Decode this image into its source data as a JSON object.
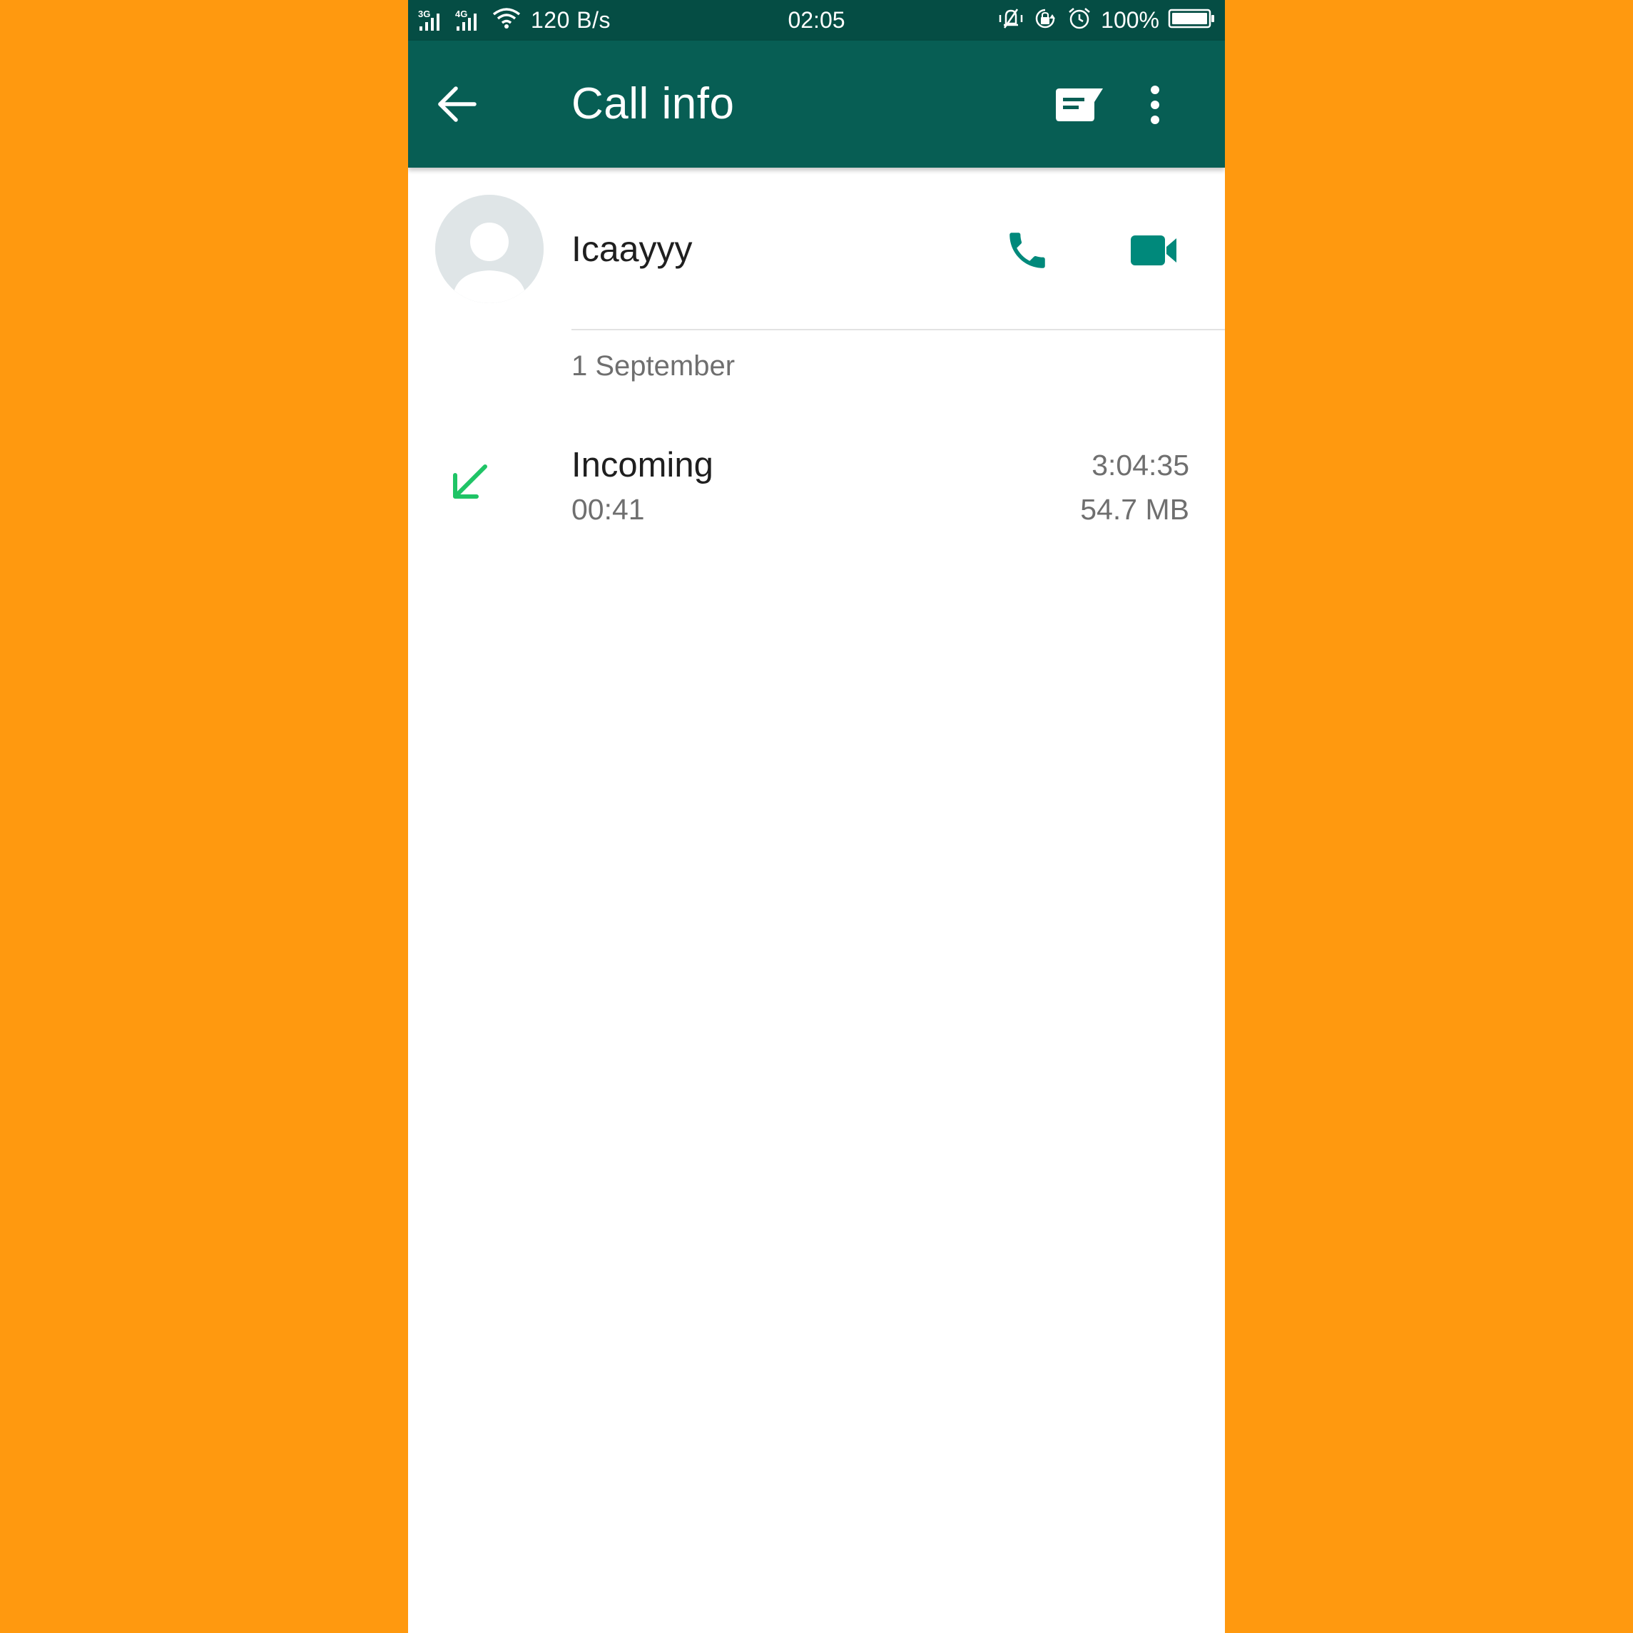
{
  "colors": {
    "background": "#FF990F",
    "status_bar": "#054D44",
    "app_bar": "#075E54",
    "accent": "#00897B",
    "incoming_arrow": "#1FC466",
    "avatar_bg": "#DFE5E7"
  },
  "status_bar": {
    "net1": "3G",
    "net2": "4G",
    "data_rate": "120 B/s",
    "time": "02:05",
    "battery": "100%",
    "icons": [
      "signal-icon",
      "wifi-icon",
      "vibrate-icon",
      "rotation-lock-icon",
      "alarm-icon",
      "battery-icon"
    ]
  },
  "app_bar": {
    "title": "Call info",
    "icons": [
      "back-arrow-icon",
      "message-icon",
      "more-vert-icon"
    ]
  },
  "contact": {
    "name": "Icaayyy",
    "icons": [
      "avatar-icon",
      "phone-icon",
      "video-camera-icon"
    ]
  },
  "call_log": {
    "date": "1 September",
    "entries": [
      {
        "direction_icon": "incoming-arrow-icon",
        "type": "Incoming",
        "duration": "00:41",
        "time": "3:04:35",
        "data": "54.7 MB"
      }
    ]
  }
}
